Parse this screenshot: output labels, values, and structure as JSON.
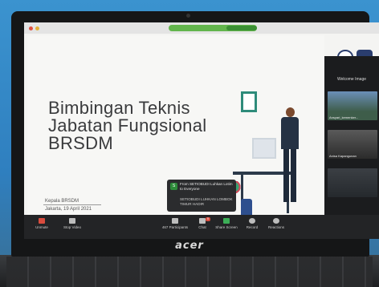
{
  "slide": {
    "title_lines": [
      "Bimbingan Teknis",
      "Jabatan Fungsional",
      "BRSDM"
    ],
    "presenter": "Kepala BRSDM",
    "place_date": "Jakarta, 19 April 2021"
  },
  "gallery": {
    "header": "Welcome Image",
    "tiles": [
      {
        "label": "Ansyari_kemenker..."
      },
      {
        "label": "Anisa Kapangunan"
      },
      {
        "label": ""
      }
    ]
  },
  "chat": {
    "avatar": "S",
    "from": "From SETIOBUDI Luhkan Lotim to Everyone",
    "message": "SETIOBUDI LUHKAN LOMBOK TIMUR HADIR"
  },
  "toolbar": {
    "items": [
      {
        "label": "Unmute",
        "icon": "microphone-icon"
      },
      {
        "label": "Stop Video",
        "icon": "camera-icon"
      },
      {
        "label": "Participants",
        "icon": "participants-icon",
        "count": "467"
      },
      {
        "label": "Chat",
        "icon": "chat-icon",
        "badge": "5"
      },
      {
        "label": "Share Screen",
        "icon": "share-screen-icon"
      },
      {
        "label": "Record",
        "icon": "record-icon"
      },
      {
        "label": "Reactions",
        "icon": "reactions-icon"
      }
    ]
  },
  "laptop": {
    "brand": "acer"
  },
  "colors": {
    "share_green": "#3cae57",
    "mute_red": "#d94c3e",
    "accent_teal": "#2e8b7a"
  }
}
